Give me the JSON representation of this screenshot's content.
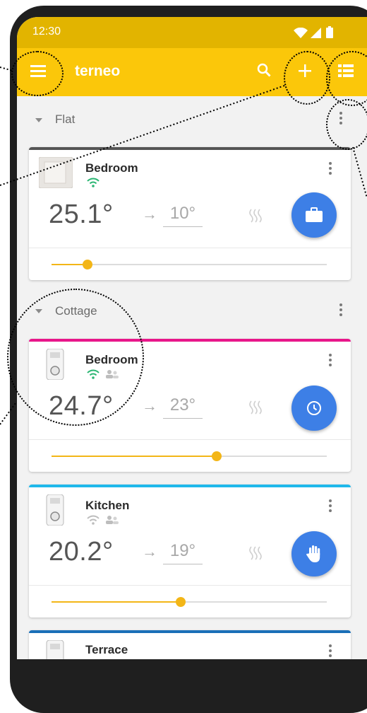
{
  "status_bar": {
    "time": "12:30"
  },
  "app_bar": {
    "title": "terneo",
    "menu_icon": "menu-icon",
    "search_icon": "search-icon",
    "add_icon": "plus-icon",
    "view_icon": "list-view-icon"
  },
  "sections": [
    {
      "title": "Flat",
      "devices": [
        {
          "name": "Bedroom",
          "current": "25.1°",
          "target": "10°",
          "mode_icon": "briefcase-icon",
          "accent": "#555555",
          "level": 0.13
        }
      ]
    },
    {
      "title": "Cottage",
      "devices": [
        {
          "name": "Bedroom",
          "current": "24.7°",
          "target": "23°",
          "mode_icon": "clock-icon",
          "accent": "#e8168a",
          "level": 0.6
        },
        {
          "name": "Kitchen",
          "current": "20.2°",
          "target": "19°",
          "mode_icon": "hand-icon",
          "accent": "#1fb8ea",
          "level": 0.47
        },
        {
          "name": "Terrace",
          "accent": "#1a6fb8"
        }
      ]
    }
  ],
  "colors": {
    "status_bar": "#e2b400",
    "app_bar": "#fbc70a",
    "fab": "#3d7fe6",
    "slider": "#f3b617"
  }
}
